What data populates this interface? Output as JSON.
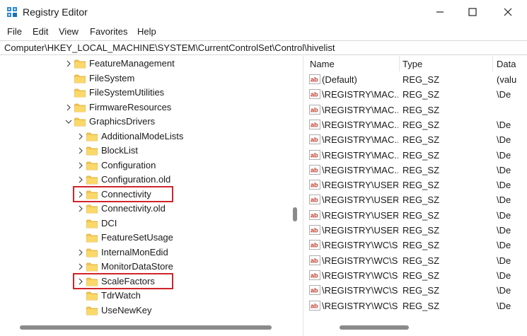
{
  "window": {
    "title": "Registry Editor"
  },
  "menu": [
    "File",
    "Edit",
    "View",
    "Favorites",
    "Help"
  ],
  "address": "Computer\\HKEY_LOCAL_MACHINE\\SYSTEM\\CurrentControlSet\\Control\\hivelist",
  "tree": [
    {
      "label": "FeatureManagement",
      "level": 0,
      "expander": "collapsed",
      "highlighted": false
    },
    {
      "label": "FileSystem",
      "level": 0,
      "expander": "none",
      "highlighted": false
    },
    {
      "label": "FileSystemUtilities",
      "level": 0,
      "expander": "none",
      "highlighted": false
    },
    {
      "label": "FirmwareResources",
      "level": 0,
      "expander": "collapsed",
      "highlighted": false
    },
    {
      "label": "GraphicsDrivers",
      "level": 0,
      "expander": "expanded",
      "highlighted": false
    },
    {
      "label": "AdditionalModeLists",
      "level": 1,
      "expander": "collapsed",
      "highlighted": false
    },
    {
      "label": "BlockList",
      "level": 1,
      "expander": "collapsed",
      "highlighted": false
    },
    {
      "label": "Configuration",
      "level": 1,
      "expander": "collapsed",
      "highlighted": false
    },
    {
      "label": "Configuration.old",
      "level": 1,
      "expander": "collapsed",
      "highlighted": false
    },
    {
      "label": "Connectivity",
      "level": 1,
      "expander": "collapsed",
      "highlighted": true
    },
    {
      "label": "Connectivity.old",
      "level": 1,
      "expander": "collapsed",
      "highlighted": false
    },
    {
      "label": "DCI",
      "level": 1,
      "expander": "none",
      "highlighted": false
    },
    {
      "label": "FeatureSetUsage",
      "level": 1,
      "expander": "none",
      "highlighted": false
    },
    {
      "label": "InternalMonEdid",
      "level": 1,
      "expander": "collapsed",
      "highlighted": false
    },
    {
      "label": "MonitorDataStore",
      "level": 1,
      "expander": "collapsed",
      "highlighted": false
    },
    {
      "label": "ScaleFactors",
      "level": 1,
      "expander": "collapsed",
      "highlighted": true
    },
    {
      "label": "TdrWatch",
      "level": 1,
      "expander": "none",
      "highlighted": false
    },
    {
      "label": "UseNewKey",
      "level": 1,
      "expander": "none",
      "highlighted": false
    }
  ],
  "list": {
    "columns": [
      "Name",
      "Type",
      "Data"
    ],
    "rows": [
      {
        "name": "(Default)",
        "type": "REG_SZ",
        "data": "(valu"
      },
      {
        "name": "\\REGISTRY\\MAC...",
        "type": "REG_SZ",
        "data": "\\De"
      },
      {
        "name": "\\REGISTRY\\MAC...",
        "type": "REG_SZ",
        "data": ""
      },
      {
        "name": "\\REGISTRY\\MAC...",
        "type": "REG_SZ",
        "data": "\\De"
      },
      {
        "name": "\\REGISTRY\\MAC...",
        "type": "REG_SZ",
        "data": "\\De"
      },
      {
        "name": "\\REGISTRY\\MAC...",
        "type": "REG_SZ",
        "data": "\\De"
      },
      {
        "name": "\\REGISTRY\\MAC...",
        "type": "REG_SZ",
        "data": "\\De"
      },
      {
        "name": "\\REGISTRY\\USER...",
        "type": "REG_SZ",
        "data": "\\De"
      },
      {
        "name": "\\REGISTRY\\USER...",
        "type": "REG_SZ",
        "data": "\\De"
      },
      {
        "name": "\\REGISTRY\\USER...",
        "type": "REG_SZ",
        "data": "\\De"
      },
      {
        "name": "\\REGISTRY\\USER...",
        "type": "REG_SZ",
        "data": "\\De"
      },
      {
        "name": "\\REGISTRY\\WC\\S...",
        "type": "REG_SZ",
        "data": "\\De"
      },
      {
        "name": "\\REGISTRY\\WC\\S...",
        "type": "REG_SZ",
        "data": "\\De"
      },
      {
        "name": "\\REGISTRY\\WC\\S...",
        "type": "REG_SZ",
        "data": "\\De"
      },
      {
        "name": "\\REGISTRY\\WC\\S...",
        "type": "REG_SZ",
        "data": "\\De"
      },
      {
        "name": "\\REGISTRY\\WC\\S...",
        "type": "REG_SZ",
        "data": "\\De"
      }
    ]
  },
  "icons": {
    "app": "registry-editor-icon",
    "window_controls": [
      "minimize-icon",
      "maximize-icon",
      "close-icon"
    ],
    "folder": "folder-icon",
    "value": "string-value-icon"
  },
  "colors": {
    "highlight_box": "#d0242b",
    "folder": "#f5c84c",
    "value_icon": "#c0392b"
  }
}
